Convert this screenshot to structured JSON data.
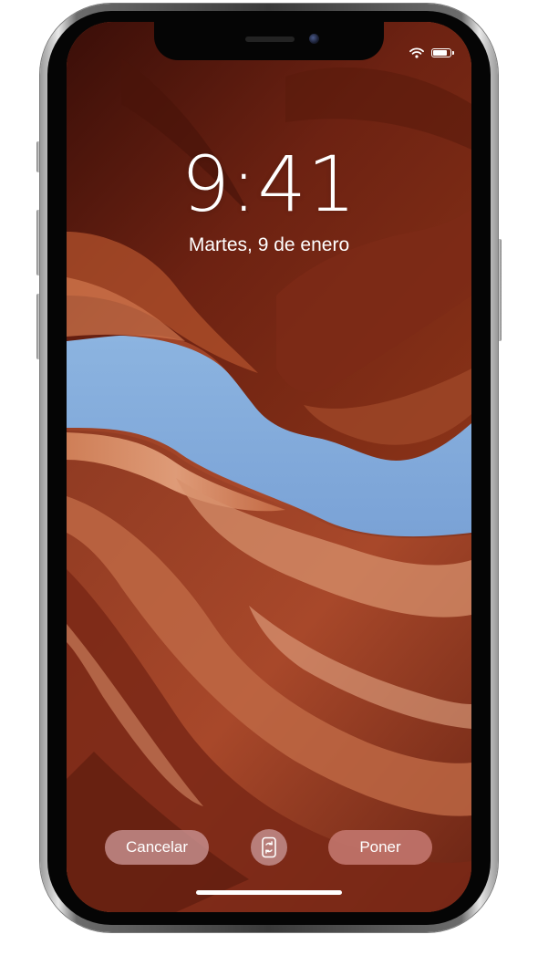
{
  "lock_screen": {
    "time": "9:41",
    "date": "Martes, 9 de enero"
  },
  "status_bar": {
    "icons": [
      "wifi-icon",
      "battery-icon"
    ],
    "battery_level": 0.9
  },
  "actions": {
    "cancel_label": "Cancelar",
    "perspective_icon": "perspective-zoom-icon",
    "set_label": "Poner"
  },
  "colors": {
    "sky": "#7ea7d8",
    "rock_dark": "#5c1d10",
    "rock_mid": "#9b3f22",
    "rock_light": "#d98a64",
    "cancel_button": "#cc9696",
    "set_button": "#c47870"
  }
}
